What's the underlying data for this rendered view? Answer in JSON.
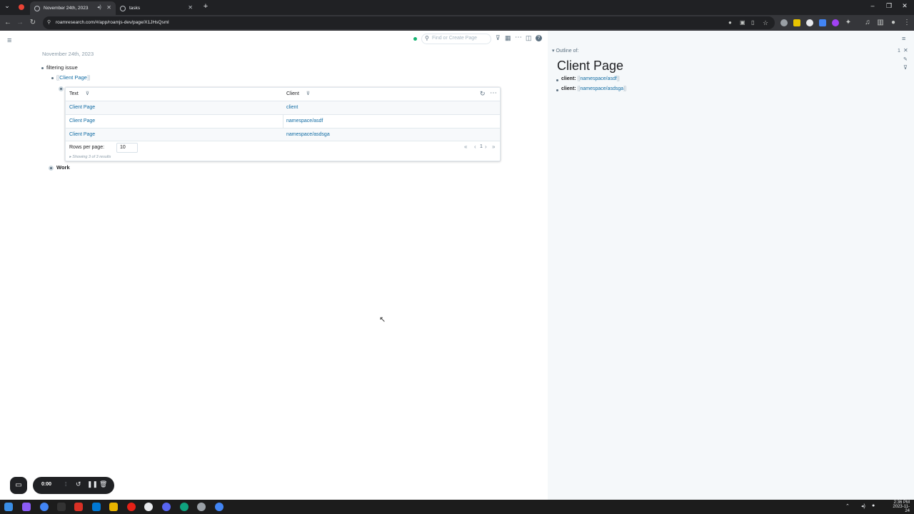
{
  "browser": {
    "tabs": [
      {
        "title": "November 24th, 2023",
        "active": true
      },
      {
        "title": "tasks",
        "active": false
      }
    ],
    "url": "roamresearch.com/#/app/roamjs-dev/page/X1JHsQsml"
  },
  "topbar": {
    "search_placeholder": "Find or Create Page"
  },
  "page": {
    "date": "November 24th, 2023",
    "blocks": {
      "filtering": "filtering issue",
      "client_ref": "Client Page",
      "work": "Work"
    }
  },
  "table": {
    "headers": [
      "Text",
      "Client"
    ],
    "rows": [
      [
        "Client Page",
        "client"
      ],
      [
        "Client Page",
        "namespace/asdf"
      ],
      [
        "Client Page",
        "namespace/asdsga"
      ]
    ],
    "rows_per_page_label": "Rows per page:",
    "rows_per_page_value": "10",
    "page_number": "1",
    "showing": "Showing 3 of 3 results"
  },
  "sidebar": {
    "outline_label": "Outline of:",
    "count": "1",
    "title": "Client Page",
    "items": [
      {
        "key": "client:",
        "value": "namespace/asdf"
      },
      {
        "key": "client:",
        "value": "namespace/asdsga"
      }
    ]
  },
  "recorder": {
    "time": "0:00"
  },
  "clock": {
    "time": "2:36 PM",
    "date": "2023-11-24"
  },
  "colors": {
    "link": "#106ba3",
    "accent_dot": "#15b371"
  }
}
